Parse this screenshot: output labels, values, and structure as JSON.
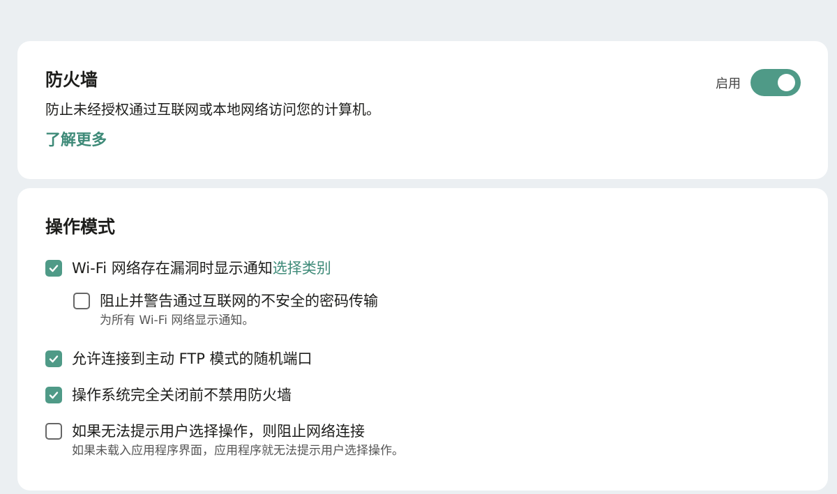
{
  "firewall": {
    "title": "防火墙",
    "description": "防止未经授权通过互联网或本地网络访问您的计算机。",
    "learn_more": "了解更多",
    "toggle_label": "启用",
    "toggle_on": true,
    "accent_color": "#4f9a87"
  },
  "mode": {
    "title": "操作模式",
    "options": [
      {
        "label": "Wi-Fi 网络存在漏洞时显示通知",
        "link": "选择类别",
        "checked": true
      },
      {
        "label": "阻止并警告通过互联网的不安全的密码传输",
        "sub": "为所有 Wi-Fi 网络显示通知。",
        "checked": false
      },
      {
        "label": "允许连接到主动 FTP 模式的随机端口",
        "checked": true
      },
      {
        "label": "操作系统完全关闭前不禁用防火墙",
        "checked": true
      },
      {
        "label": "如果无法提示用户选择操作，则阻止网络连接",
        "sub": "如果未载入应用程序界面，应用程序就无法提示用户选择操作。",
        "checked": false
      }
    ]
  },
  "icons": {
    "checkbox_checked": "checkmark-icon"
  }
}
